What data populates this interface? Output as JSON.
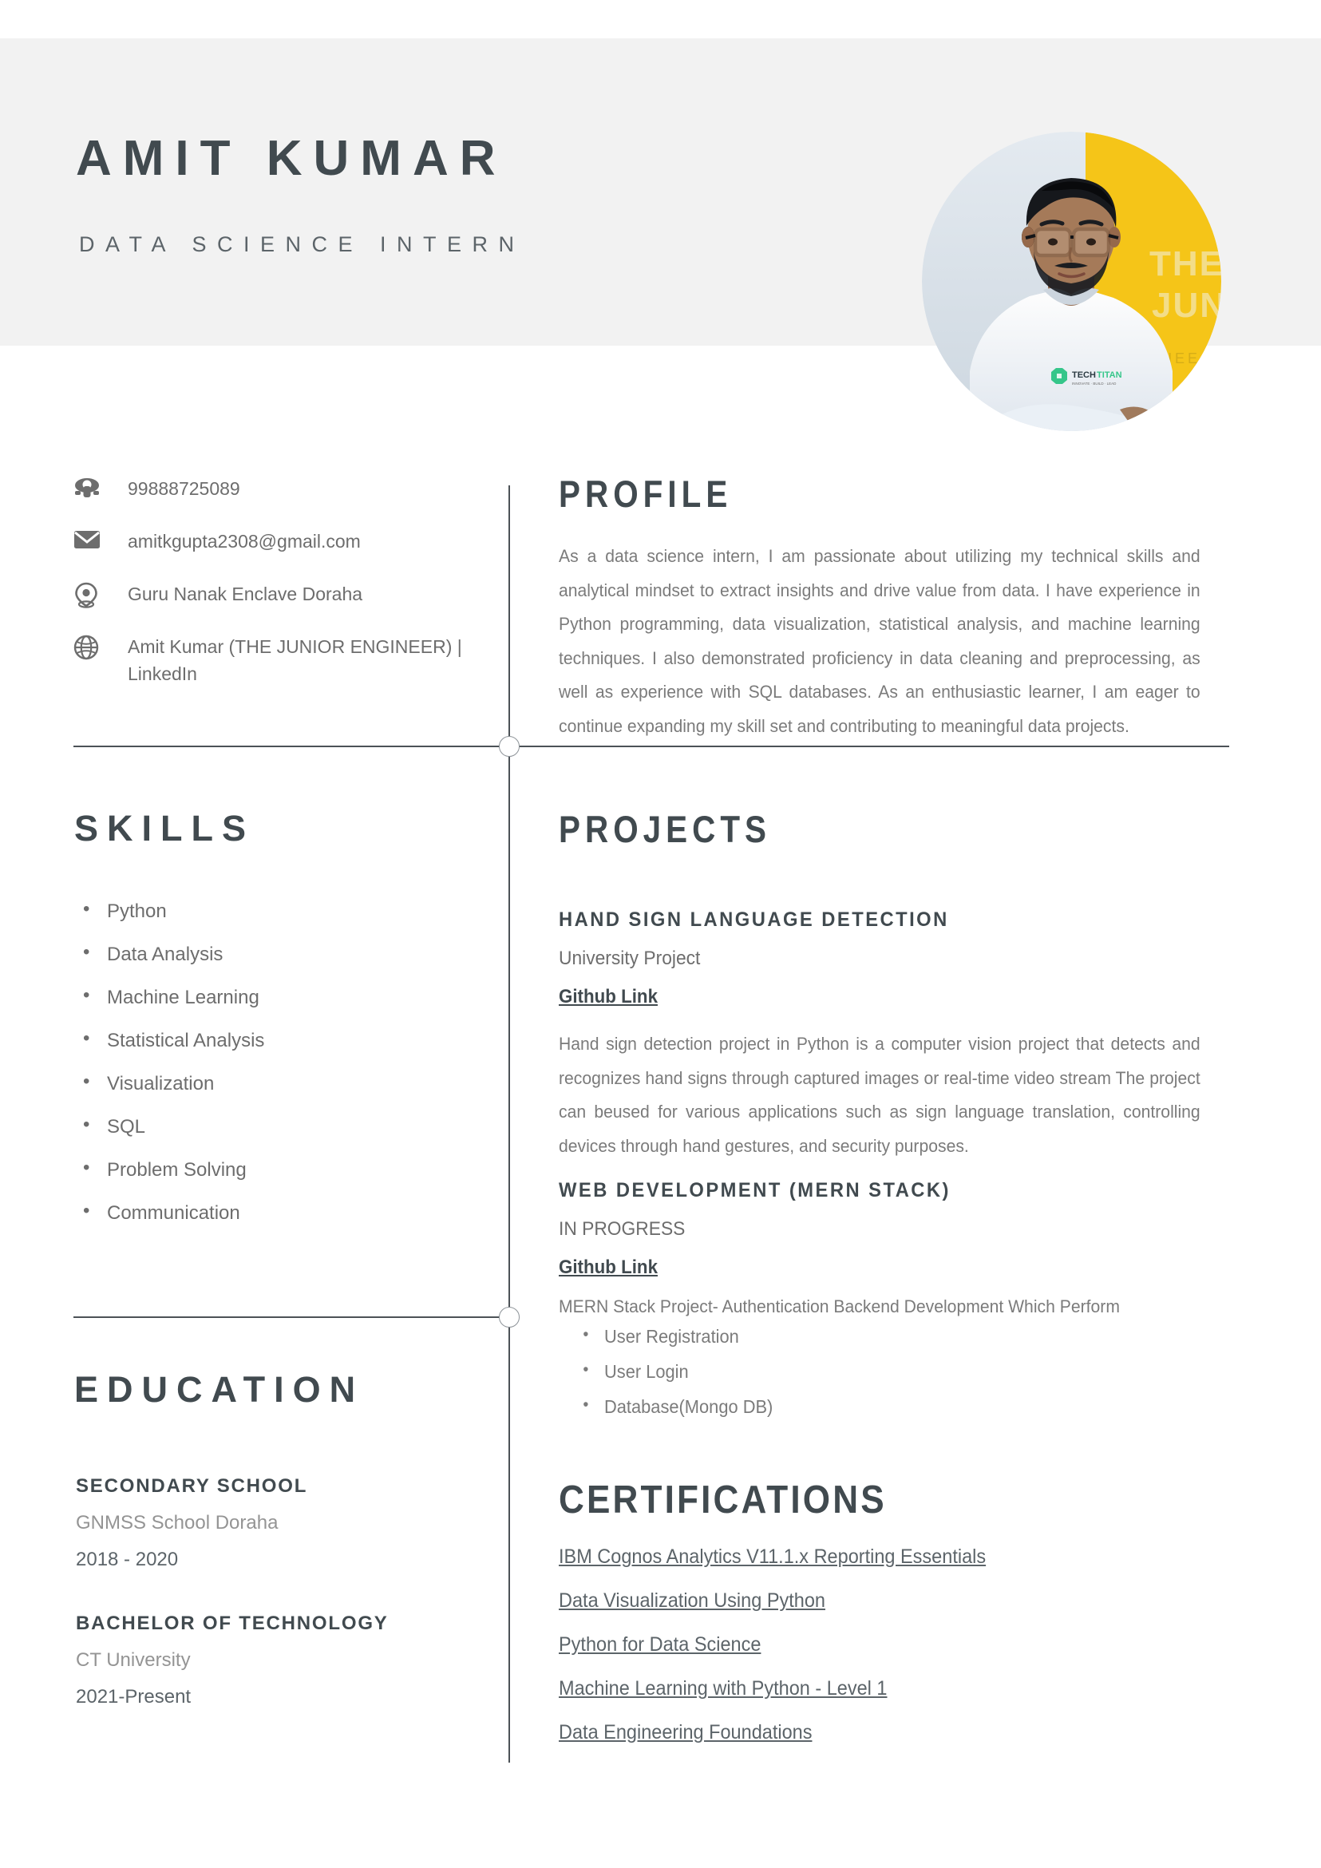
{
  "header": {
    "name": "AMIT KUMAR",
    "job_title": "DATA SCIENCE INTERN",
    "band_color": "#f2f2f2",
    "heading_color": "#414a4f",
    "photo": {
      "alt_name": "profile-photo",
      "shirt_logo_text": "TECHTITAN",
      "background_text_line1": "THE",
      "background_text_line2": "JUN",
      "background_text_line3": "NEE",
      "background_accent": "#f5c518",
      "wall_color": "#dde4ea"
    }
  },
  "contact": {
    "items": [
      {
        "icon": "phone-icon",
        "value": "99888725089"
      },
      {
        "icon": "envelope-icon",
        "value": "amitkgupta2308@gmail.com"
      },
      {
        "icon": "location-pin-icon",
        "value": "Guru Nanak Enclave Doraha"
      },
      {
        "icon": "globe-icon",
        "value": "Amit Kumar (THE JUNIOR ENGINEER) | LinkedIn"
      }
    ]
  },
  "profile": {
    "heading": "PROFILE",
    "text": "As a data science intern, I am passionate about utilizing my technical skills and analytical mindset to extract insights and drive value from data. I have experience in Python programming, data visualization, statistical analysis, and machine learning techniques. I also demonstrated proficiency in data cleaning and preprocessing, as well as experience with SQL databases. As an enthusiastic learner, I am eager to continue expanding my skill set and contributing to meaningful data projects."
  },
  "skills": {
    "heading": "SKILLS",
    "items": [
      "Python",
      "Data Analysis",
      "Machine Learning",
      "Statistical Analysis",
      "Visualization",
      "SQL",
      "Problem Solving",
      "Communication"
    ]
  },
  "education": {
    "heading": "EDUCATION",
    "entries": [
      {
        "degree": "SECONDARY SCHOOL",
        "school": "GNMSS School Doraha",
        "years": "2018 - 2020"
      },
      {
        "degree": "BACHELOR OF TECHNOLOGY",
        "school": "CT University",
        "years": "2021-Present"
      }
    ]
  },
  "projects": {
    "heading": "PROJECTS",
    "items": [
      {
        "title": "HAND SIGN LANGUAGE DETECTION",
        "subtitle": "University Project",
        "link_label": "Github Link",
        "description": "Hand sign detection project in Python is a computer vision project that detects and recognizes hand signs through captured images or real-time video stream The project can beused for various applications such as sign language translation, controlling devices through hand gestures, and security purposes.",
        "bullets": []
      },
      {
        "title": "WEB DEVELOPMENT (MERN STACK)",
        "subtitle": "IN PROGRESS",
        "link_label": "Github Link",
        "description": "MERN Stack Project- Authentication Backend Development Which Perform",
        "bullets": [
          "User Registration",
          "User Login",
          "Database(Mongo DB)"
        ]
      }
    ]
  },
  "certifications": {
    "heading": "CERTIFICATIONS",
    "items": [
      "IBM Cognos Analytics V11.1.x Reporting Essentials",
      "Data Visualization Using Python",
      "Python for Data Science",
      "Machine Learning with Python - Level 1",
      "Data Engineering Foundations"
    ]
  }
}
